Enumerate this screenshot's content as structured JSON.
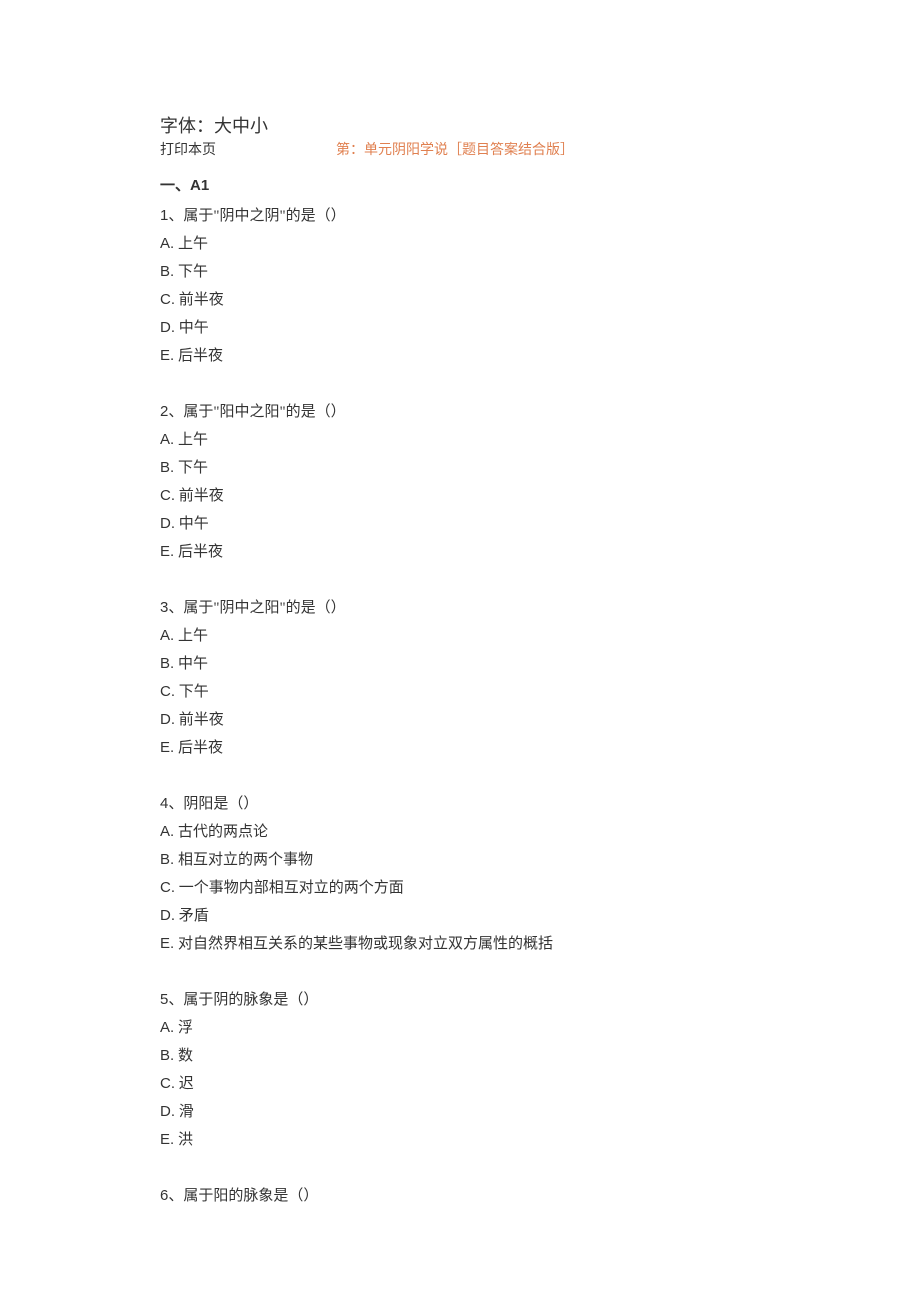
{
  "header": {
    "font_label": "字体：大中小",
    "print_label": "打印本页",
    "title": "第：单元阴阳学说［题目答案结合版］"
  },
  "section": {
    "heading_prefix": "一、",
    "heading_code": "A1"
  },
  "questions": [
    {
      "num": "1",
      "text": "、属于\"阴中之阴\"的是（）",
      "options": [
        {
          "letter": "A.",
          "text": " 上午"
        },
        {
          "letter": "B.",
          "text": " 下午"
        },
        {
          "letter": "C.",
          "text": " 前半夜"
        },
        {
          "letter": "D.",
          "text": " 中午"
        },
        {
          "letter": "E.",
          "text": " 后半夜"
        }
      ]
    },
    {
      "num": "2",
      "text": "、属于\"阳中之阳\"的是（）",
      "options": [
        {
          "letter": "A.",
          "text": " 上午"
        },
        {
          "letter": "B.",
          "text": " 下午"
        },
        {
          "letter": "C.",
          "text": " 前半夜"
        },
        {
          "letter": "D.",
          "text": " 中午"
        },
        {
          "letter": "E.",
          "text": " 后半夜"
        }
      ]
    },
    {
      "num": "3",
      "text": "、属于\"阴中之阳\"的是（）",
      "options": [
        {
          "letter": "A.",
          "text": " 上午"
        },
        {
          "letter": "B.",
          "text": " 中午"
        },
        {
          "letter": "C.",
          "text": " 下午"
        },
        {
          "letter": "D.",
          "text": " 前半夜"
        },
        {
          "letter": "E.",
          "text": " 后半夜"
        }
      ]
    },
    {
      "num": "4",
      "text": "、阴阳是（）",
      "options": [
        {
          "letter": "A.",
          "text": " 古代的两点论"
        },
        {
          "letter": "B.",
          "text": " 相互对立的两个事物"
        },
        {
          "letter": "C.",
          "text": " 一个事物内部相互对立的两个方面"
        },
        {
          "letter": "D.",
          "text": " 矛盾"
        },
        {
          "letter": "E.",
          "text": " 对自然界相互关系的某些事物或现象对立双方属性的概括"
        }
      ]
    },
    {
      "num": "5",
      "text": "、属于阴的脉象是（）",
      "options": [
        {
          "letter": "A.",
          "text": " 浮"
        },
        {
          "letter": "B.",
          "text": " 数"
        },
        {
          "letter": "C.",
          "text": " 迟"
        },
        {
          "letter": "D.",
          "text": " 滑"
        },
        {
          "letter": "E.",
          "text": " 洪"
        }
      ]
    },
    {
      "num": "6",
      "text": "、属于阳的脉象是（）",
      "options": []
    }
  ]
}
